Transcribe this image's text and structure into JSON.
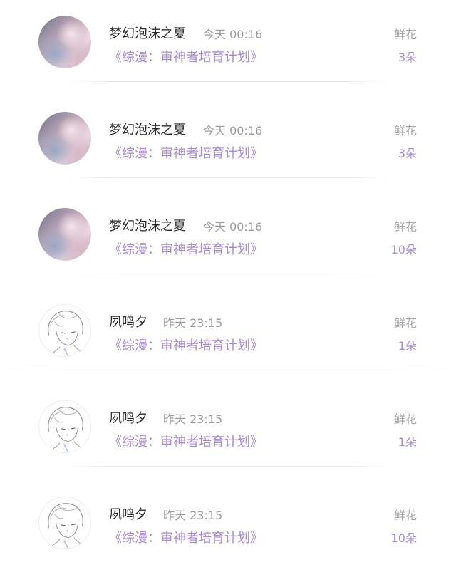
{
  "gift_records": [
    {
      "user": "梦幻泡沫之夏",
      "time": "今天 00:16",
      "book": "《综漫：审神者培育计划》",
      "gift_type": "鲜花",
      "gift_count": "3朵",
      "avatar": "pink-anime-avatar"
    },
    {
      "user": "梦幻泡沫之夏",
      "time": "今天 00:16",
      "book": "《综漫：审神者培育计划》",
      "gift_type": "鲜花",
      "gift_count": "3朵",
      "avatar": "pink-anime-avatar"
    },
    {
      "user": "梦幻泡沫之夏",
      "time": "今天 00:16",
      "book": "《综漫：审神者培育计划》",
      "gift_type": "鲜花",
      "gift_count": "10朵",
      "avatar": "pink-anime-avatar"
    },
    {
      "user": "夙鸣夕",
      "time": "昨天 23:15",
      "book": "《综漫：审神者培育计划》",
      "gift_type": "鲜花",
      "gift_count": "1朵",
      "avatar": "sketch-anime-avatar"
    },
    {
      "user": "夙鸣夕",
      "time": "昨天 23:15",
      "book": "《综漫：审神者培育计划》",
      "gift_type": "鲜花",
      "gift_count": "1朵",
      "avatar": "sketch-anime-avatar"
    },
    {
      "user": "夙鸣夕",
      "time": "昨天 23:15",
      "book": "《综漫：审神者培育计划》",
      "gift_type": "鲜花",
      "gift_count": "10朵",
      "avatar": "sketch-anime-avatar"
    }
  ],
  "colors": {
    "name": "#2b2b2b",
    "time": "#9c9c9c",
    "accent": "#a98ad2",
    "gift_type": "#a6a6a6",
    "divider": "#e6e6e6"
  }
}
